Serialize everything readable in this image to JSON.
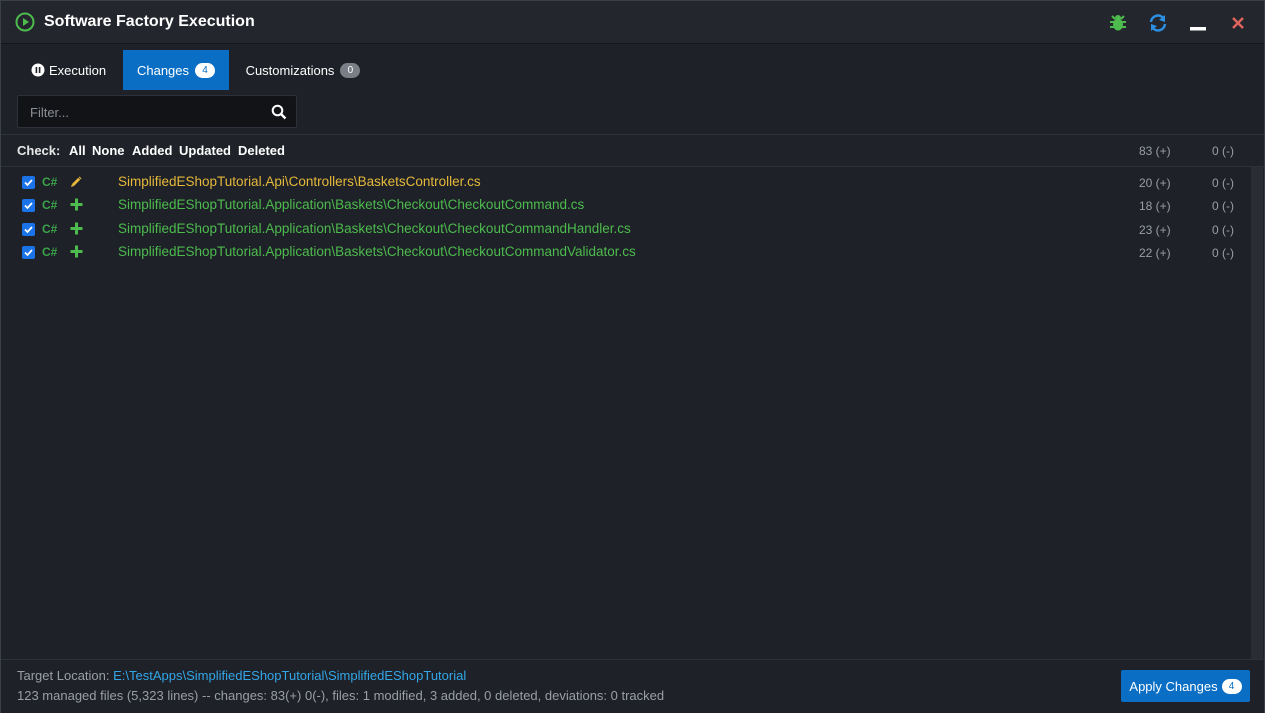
{
  "window": {
    "title": "Software Factory Execution",
    "icons": [
      "play-icon",
      "bug-icon",
      "refresh-icon",
      "minimize-icon",
      "close-icon"
    ]
  },
  "tabs": [
    {
      "label": "Execution",
      "icon": "pause-icon",
      "active": false
    },
    {
      "label": "Changes",
      "badge": "4",
      "active": true
    },
    {
      "label": "Customizations",
      "badge": "0",
      "active": false
    }
  ],
  "filter": {
    "placeholder": "Filter..."
  },
  "check": {
    "label": "Check:",
    "options": [
      "All",
      "None",
      "Added",
      "Updated",
      "Deleted"
    ],
    "total_plus": "83 (+)",
    "total_minus": "0 (-)"
  },
  "files": [
    {
      "lang": "C#",
      "change": "modified",
      "icon": "pencil-icon",
      "path": "SimplifiedEShopTutorial.Api\\Controllers\\BasketsController.cs",
      "plus": "20 (+)",
      "minus": "0 (-)",
      "checked": true
    },
    {
      "lang": "C#",
      "change": "added",
      "icon": "plus-icon",
      "path": "SimplifiedEShopTutorial.Application\\Baskets\\Checkout\\CheckoutCommand.cs",
      "plus": "18 (+)",
      "minus": "0 (-)",
      "checked": true
    },
    {
      "lang": "C#",
      "change": "added",
      "icon": "plus-icon",
      "path": "SimplifiedEShopTutorial.Application\\Baskets\\Checkout\\CheckoutCommandHandler.cs",
      "plus": "23 (+)",
      "minus": "0 (-)",
      "checked": true
    },
    {
      "lang": "C#",
      "change": "added",
      "icon": "plus-icon",
      "path": "SimplifiedEShopTutorial.Application\\Baskets\\Checkout\\CheckoutCommandValidator.cs",
      "plus": "22 (+)",
      "minus": "0 (-)",
      "checked": true
    }
  ],
  "footer": {
    "target_label": "Target Location:",
    "target_path": "E:\\TestApps\\SimplifiedEShopTutorial\\SimplifiedEShopTutorial",
    "summary": "123 managed files (5,323 lines) -- changes: 83(+) 0(-), files: 1 modified, 3 added, 0 deleted, deviations: 0 tracked",
    "apply_label": "Apply Changes",
    "apply_badge": "4"
  },
  "colors": {
    "accent": "#0a6ec4",
    "modified": "#e6b93a",
    "added": "#4dbb4d",
    "link": "#33a6e8",
    "close": "#e0645c"
  }
}
